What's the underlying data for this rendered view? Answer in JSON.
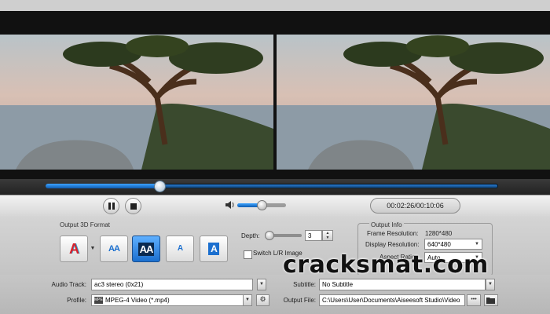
{
  "player": {
    "time": "00:02:26/00:10:06",
    "seek_fraction": 0.25,
    "volume_fraction": 0.45
  },
  "format3d": {
    "label": "Output 3D Format",
    "buttons": [
      {
        "name": "anaglyph",
        "glyph": "A"
      },
      {
        "name": "side-by-side-half",
        "glyph": "AA"
      },
      {
        "name": "side-by-side-full",
        "glyph": "AA"
      },
      {
        "name": "top-bottom-half",
        "glyph": "A"
      },
      {
        "name": "top-bottom-full",
        "glyph": "A"
      }
    ],
    "selected_index": 2
  },
  "depth": {
    "label": "Depth:",
    "value": "3"
  },
  "switch_lr": {
    "label": "Switch L/R Image",
    "checked": false
  },
  "output_info": {
    "title": "Output Info",
    "frame_resolution_label": "Frame Resolution:",
    "frame_resolution_value": "1280*480",
    "display_resolution_label": "Display Resolution:",
    "display_resolution_value": "640*480",
    "aspect_ratio_label": "Aspect Ratio:",
    "aspect_ratio_value": "Auto"
  },
  "audio_track": {
    "label": "Audio Track:",
    "value": "ac3 stereo (0x21)"
  },
  "subtitle": {
    "label": "Subtitle:",
    "value": "No Subtitle"
  },
  "profile": {
    "label": "Profile:",
    "value": "MPEG-4 Video (*.mp4)",
    "icon_text": "MPEG4"
  },
  "output_file": {
    "label": "Output File:",
    "value": "C:\\Users\\User\\Documents\\Aiseesoft Studio\\Video",
    "browse_label": "•••"
  },
  "watermark": "cracksmat.com",
  "colors": {
    "accent": "#1b6fcf",
    "seek": "#2a7dd2"
  }
}
